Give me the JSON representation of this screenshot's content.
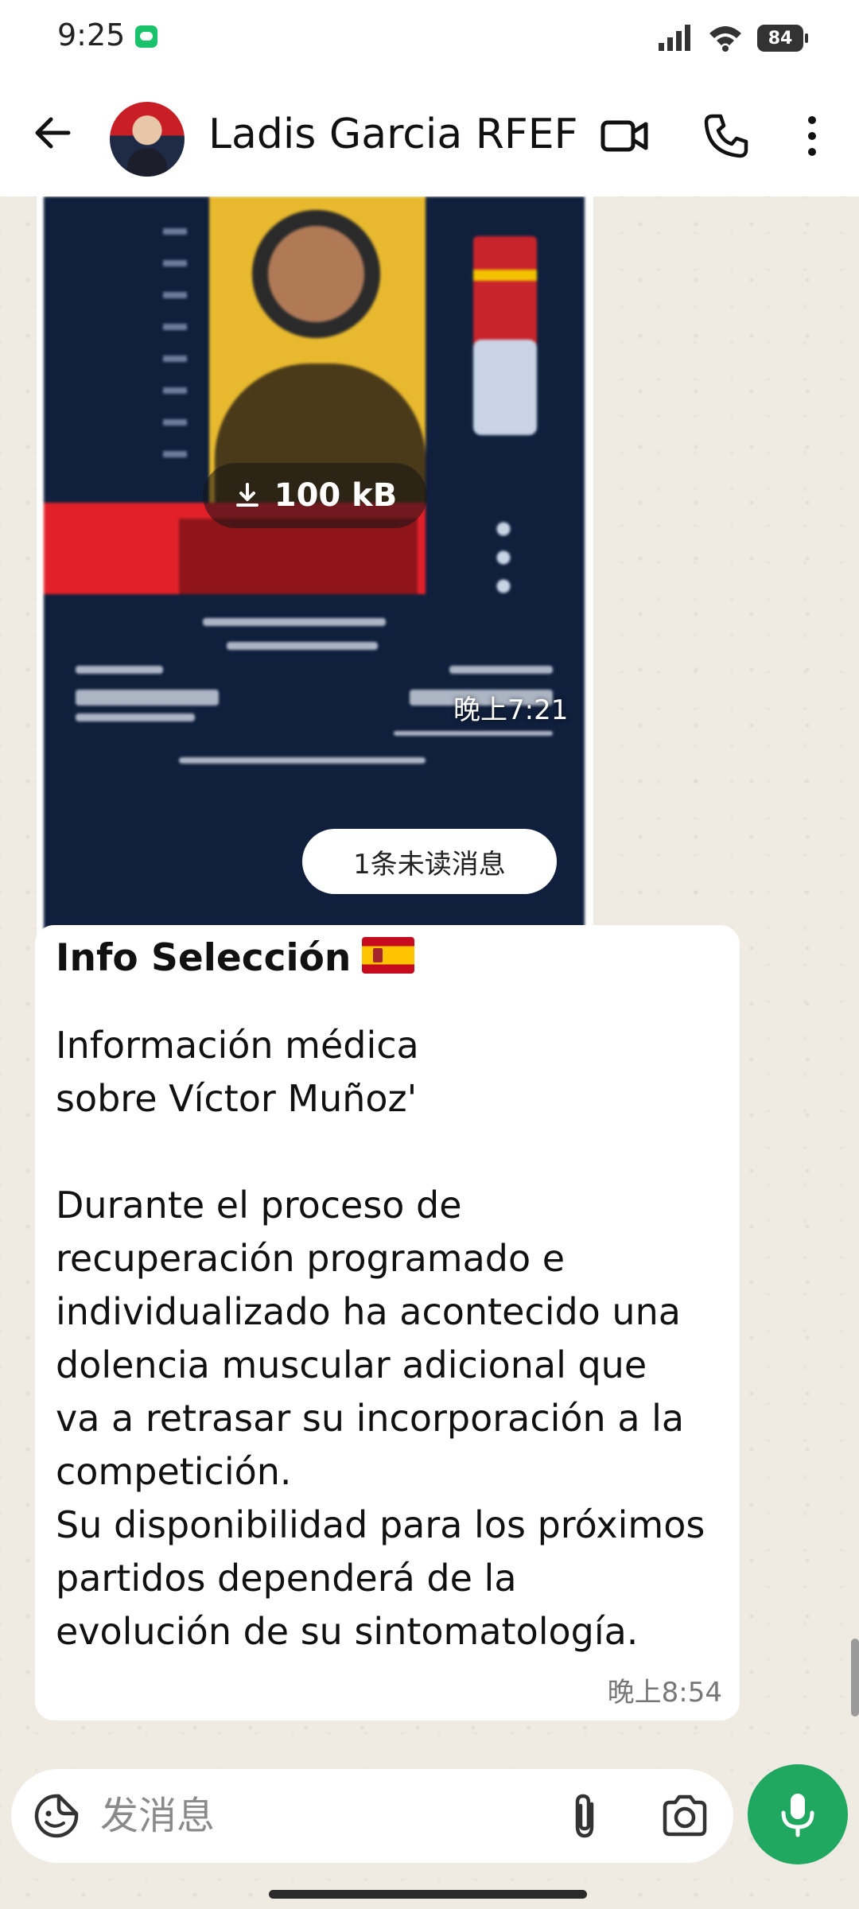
{
  "status_bar": {
    "time": "9:25",
    "battery": "84"
  },
  "header": {
    "contact_name": "Ladis Garcia RFEF"
  },
  "messages": {
    "image": {
      "size_label": "100 kB",
      "time": "晚上7:21"
    },
    "unread_divider": "1条未读消息",
    "text": {
      "title": "Info Selección",
      "lines_a": [
        "Información médica",
        "sobre Víctor Muñoz'"
      ],
      "lines_b": [
        "Durante el proceso de",
        "recuperación programado e",
        "individualizado ha acontecido una",
        "dolencia muscular adicional que",
        "va a retrasar su incorporación a la",
        "competición.",
        "Su disponibilidad para los próximos",
        "partidos dependerá de la",
        "evolución de su sintomatología."
      ],
      "time": "晚上8:54"
    }
  },
  "input": {
    "placeholder": "发消息"
  },
  "colors": {
    "accent_green": "#20a861",
    "chat_bg": "#efeae2"
  }
}
